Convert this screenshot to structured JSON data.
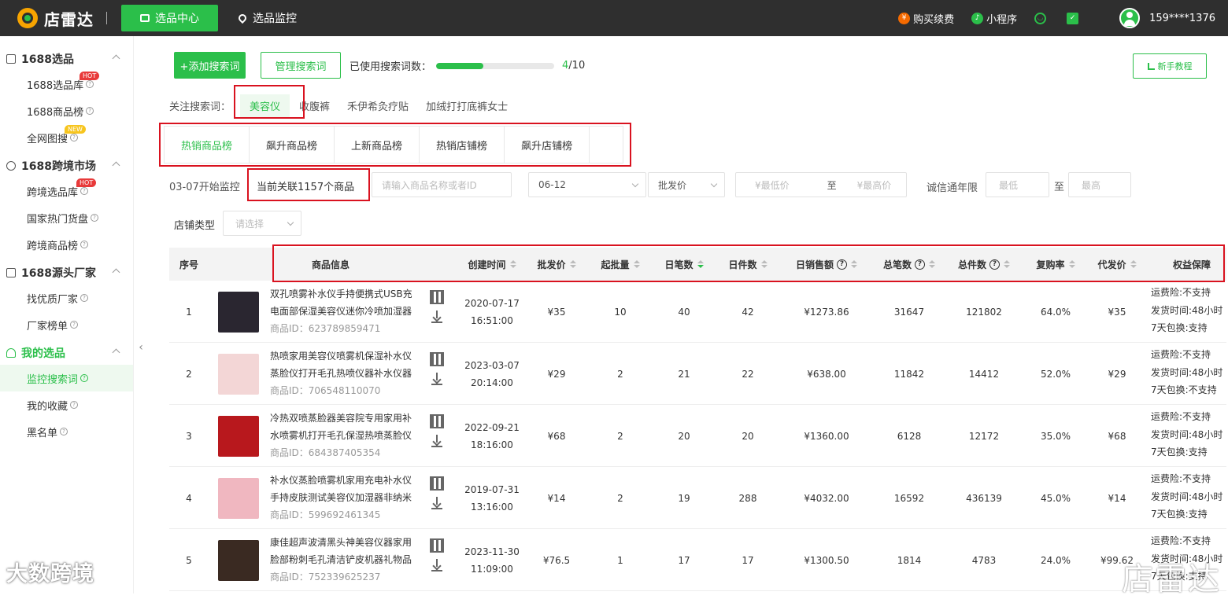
{
  "app": {
    "name": "店雷达"
  },
  "topnav": {
    "active": "选品中心",
    "item": "选品监控",
    "buy": "购买续费",
    "mini": "小程序",
    "phone": "159****1376"
  },
  "sidebar": {
    "sections": [
      {
        "title": "1688选品",
        "items": [
          {
            "label": "1688选品库",
            "badge": "HOT"
          },
          {
            "label": "1688商品榜"
          },
          {
            "label": "全网图搜",
            "badge": "NEW"
          }
        ]
      },
      {
        "title": "1688跨境市场",
        "items": [
          {
            "label": "跨境选品库",
            "badge": "HOT"
          },
          {
            "label": "国家热门货盘"
          },
          {
            "label": "跨境商品榜"
          }
        ]
      },
      {
        "title": "1688源头厂家",
        "items": [
          {
            "label": "找优质厂家"
          },
          {
            "label": "厂家榜单"
          }
        ]
      },
      {
        "title": "我的选品",
        "items": [
          {
            "label": "监控搜索词",
            "active": true
          },
          {
            "label": "我的收藏"
          },
          {
            "label": "黑名单"
          }
        ]
      }
    ]
  },
  "toolbar": {
    "add": "+添加搜索词",
    "manage": "管理搜索词",
    "usage_label": "已使用搜索词数：",
    "used": "4",
    "total": "/10",
    "used_fraction": 0.4,
    "guide": "新手教程"
  },
  "keywords": {
    "label": "关注搜索词：",
    "items": [
      "美容仪",
      "收腹裤",
      "禾伊希灸疗贴",
      "加绒打打底裤女士"
    ]
  },
  "tabs": [
    "热销商品榜",
    "飙升商品榜",
    "上新商品榜",
    "热销店铺榜",
    "飙升店铺榜"
  ],
  "filters": {
    "monitor_start": "03-07开始监控",
    "related": "当前关联1157个商品",
    "search_placeholder": "请输入商品名称或者ID",
    "date": "06-12",
    "price_type": "批发价",
    "min_price": "¥最低价",
    "to": "至",
    "max_price": "¥最高价",
    "cx_label": "诚信通年限",
    "min": "最低",
    "to2": "至",
    "max": "最高",
    "shop_label": "店铺类型",
    "shop_placeholder": "请选择"
  },
  "table": {
    "headers": [
      "序号",
      "商品信息",
      "创建时间",
      "批发价",
      "起批量",
      "日笔数",
      "日件数",
      "日销售额",
      "总笔数",
      "总件数",
      "复购率",
      "代发价",
      "权益保障"
    ],
    "rows": [
      {
        "no": "1",
        "title": "双孔喷雾补水仪手持便携式USB充电面部保湿美容仪迷你冷喷加湿器",
        "id": "商品ID：623789859471",
        "date": "2020-07-17",
        "time": "16:51:00",
        "price": "¥35",
        "moq": "10",
        "daily_orders": "40",
        "daily_pieces": "42",
        "daily_sales": "¥1273.86",
        "total_orders": "31647",
        "total_pieces": "121802",
        "repurchase": "64.0%",
        "dropship": "¥35",
        "rights": [
          "运费险:不支持",
          "发货时间:48小时",
          "7天包换:支持"
        ],
        "thumb": "#2a2630"
      },
      {
        "no": "2",
        "title": "热喷家用美容仪喷雾机保湿补水仪蒸脸仪打开毛孔热喷仪器补水仪器",
        "id": "商品ID：706548110070",
        "date": "2023-03-07",
        "time": "20:14:00",
        "price": "¥29",
        "moq": "2",
        "daily_orders": "21",
        "daily_pieces": "22",
        "daily_sales": "¥638.00",
        "total_orders": "11842",
        "total_pieces": "14412",
        "repurchase": "52.0%",
        "dropship": "¥29",
        "rights": [
          "运费险:不支持",
          "发货时间:48小时",
          "7天包换:不支持"
        ],
        "thumb": "#f3d6d6"
      },
      {
        "no": "3",
        "title": "冷热双喷蒸脸器美容院专用家用补水喷雾机打开毛孔保湿热喷蒸脸仪",
        "id": "商品ID：684387405354",
        "date": "2022-09-21",
        "time": "18:16:00",
        "price": "¥68",
        "moq": "2",
        "daily_orders": "20",
        "daily_pieces": "20",
        "daily_sales": "¥1360.00",
        "total_orders": "6128",
        "total_pieces": "12172",
        "repurchase": "35.0%",
        "dropship": "¥68",
        "rights": [
          "运费险:不支持",
          "发货时间:48小时",
          "7天包换:支持"
        ],
        "thumb": "#b8181d"
      },
      {
        "no": "4",
        "title": "补水仪蒸脸喷雾机家用充电补水仪手持皮肤测试美容仪加湿器非纳米",
        "id": "商品ID：599692461345",
        "date": "2019-07-31",
        "time": "13:16:00",
        "price": "¥14",
        "moq": "2",
        "daily_orders": "19",
        "daily_pieces": "288",
        "daily_sales": "¥4032.00",
        "total_orders": "16592",
        "total_pieces": "436139",
        "repurchase": "45.0%",
        "dropship": "¥14",
        "rights": [
          "运费险:不支持",
          "发货时间:48小时",
          "7天包换:支持"
        ],
        "thumb": "#f0b7c0"
      },
      {
        "no": "5",
        "title": "康佳超声波清黑头神美容仪器家用脸部粉刺毛孔清洁铲皮机器礼物品",
        "id": "商品ID：752339625237",
        "date": "2023-11-30",
        "time": "11:09:00",
        "price": "¥76.5",
        "moq": "1",
        "daily_orders": "17",
        "daily_pieces": "17",
        "daily_sales": "¥1300.50",
        "total_orders": "1814",
        "total_pieces": "4783",
        "repurchase": "24.0%",
        "dropship": "¥99.62",
        "rights": [
          "运费险:不支持",
          "发货时间:48小时",
          "7天包换:支持"
        ],
        "thumb": "#3a2a22"
      }
    ]
  },
  "watermark": {
    "left": "大数跨境",
    "right": "店雷达"
  },
  "colors": {
    "brand_green": "#2bbf4a",
    "annotation_red": "#d9121f",
    "topbar": "#2f2f2f"
  }
}
